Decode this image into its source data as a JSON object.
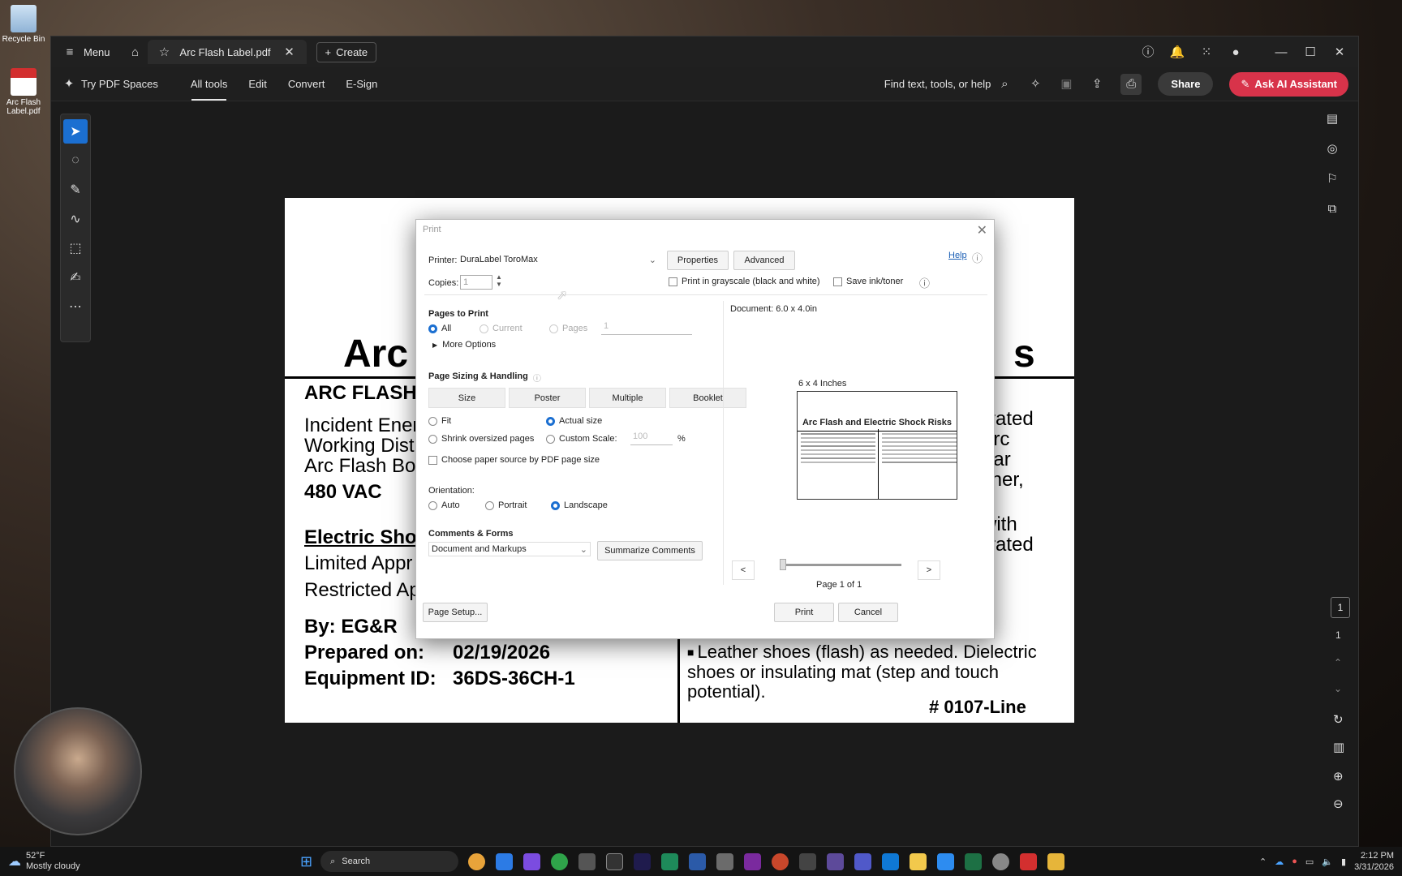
{
  "desktop": {
    "recycle_bin": "Recycle Bin",
    "pdf_file": "Arc Flash Label.pdf"
  },
  "titlebar": {
    "menu": "Menu",
    "tab_title": "Arc Flash Label.pdf",
    "create": "Create"
  },
  "toolbar": {
    "try_spaces": "Try PDF Spaces",
    "tabs": [
      "All tools",
      "Edit",
      "Convert",
      "E-Sign"
    ],
    "find": "Find text, tools, or help",
    "share": "Share",
    "ask_ai": "Ask AI Assistant"
  },
  "right_rail": {
    "page_current": "1",
    "page_total": "1"
  },
  "pdf": {
    "title_left": "Arc",
    "title_right": "s",
    "left_lines": [
      "ARC FLASH",
      "Incident Ener",
      "Working Dist",
      "Arc Flash Bo",
      "480 VAC",
      "Electric Sho",
      "Limited Appr",
      "Restricted Ap",
      "By:   EG&R",
      "Prepared on:",
      "Equipment ID:"
    ],
    "prepared_on": "02/19/2026",
    "equipment_id": "36DS-36CH-1",
    "right_lines": [
      "-rated",
      "arc",
      "ear",
      "liner,",
      "with",
      "-rated"
    ],
    "bullet_text": "Leather shoes (flash) as needed. Dielectric shoes or insulating mat (step and touch potential).",
    "label_no": "# 0107-Line"
  },
  "print_dialog": {
    "title": "Print",
    "printer_label": "Printer:",
    "printer_value": "DuraLabel ToroMax",
    "properties": "Properties",
    "advanced": "Advanced",
    "help": "Help",
    "copies_label": "Copies:",
    "copies_value": "1",
    "grayscale": "Print in grayscale (black and white)",
    "save_ink": "Save ink/toner",
    "pages_to_print": "Pages to Print",
    "all": "All",
    "current": "Current",
    "pages": "Pages",
    "pages_value": "1",
    "more_options": "More Options",
    "sizing": "Page Sizing & Handling",
    "seg": [
      "Size",
      "Poster",
      "Multiple",
      "Booklet"
    ],
    "fit": "Fit",
    "actual_size": "Actual size",
    "shrink": "Shrink oversized pages",
    "custom_scale": "Custom Scale:",
    "scale_value": "100",
    "percent": "%",
    "choose_paper": "Choose paper source by PDF page size",
    "orientation": "Orientation:",
    "auto": "Auto",
    "portrait": "Portrait",
    "landscape": "Landscape",
    "comments_forms": "Comments & Forms",
    "comments_value": "Document and Markups",
    "summarize": "Summarize Comments",
    "document_size": "Document: 6.0 x 4.0in",
    "preview_size": "6 x 4 Inches",
    "preview_title": "Arc Flash and Electric Shock Risks",
    "prev": "<",
    "next": ">",
    "page_of": "Page 1 of 1",
    "page_setup": "Page Setup...",
    "print": "Print",
    "cancel": "Cancel"
  },
  "taskbar": {
    "temp": "52°F",
    "weather": "Mostly cloudy",
    "search": "Search",
    "time": "2:12 PM",
    "date": "3/31/2026"
  }
}
